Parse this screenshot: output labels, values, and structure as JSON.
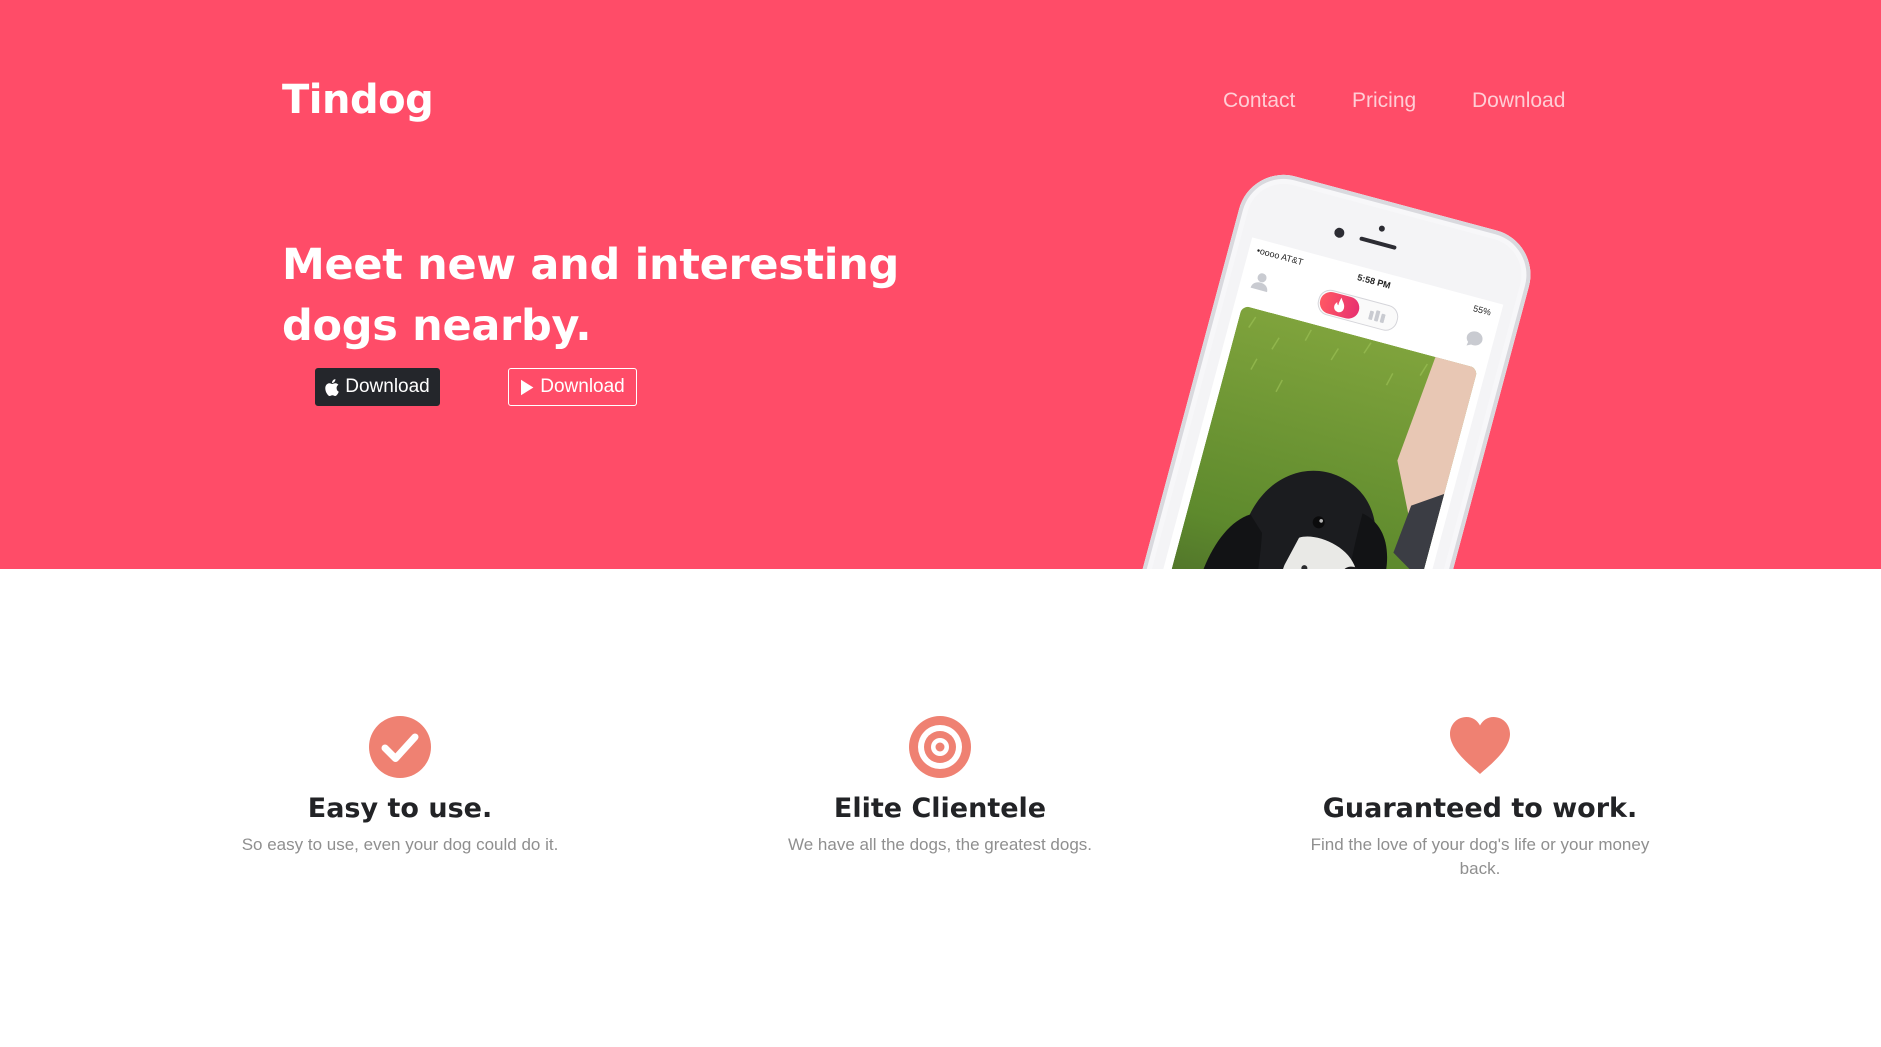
{
  "brand": "Tindog",
  "nav": {
    "contact": "Contact",
    "pricing": "Pricing",
    "download": "Download"
  },
  "hero": {
    "headline": "Meet new and interesting dogs nearby.",
    "apple_button": "Download",
    "play_button": "Download",
    "background_color": "#ff4c68"
  },
  "phone": {
    "carrier": "•oooo AT&T",
    "time": "5:58 PM",
    "battery": "55%"
  },
  "features": [
    {
      "icon": "check-circle-icon",
      "title": "Easy to use.",
      "text": "So easy to use, even your dog could do it."
    },
    {
      "icon": "bullseye-icon",
      "title": "Elite Clientele",
      "text": "We have all the dogs, the greatest dogs."
    },
    {
      "icon": "heart-icon",
      "title": "Guaranteed to work.",
      "text": "Find the love of your dog's life or your money back."
    }
  ],
  "colors": {
    "accent": "#ff4c68",
    "icon": "#ef8172",
    "dark_button": "#24262b"
  }
}
